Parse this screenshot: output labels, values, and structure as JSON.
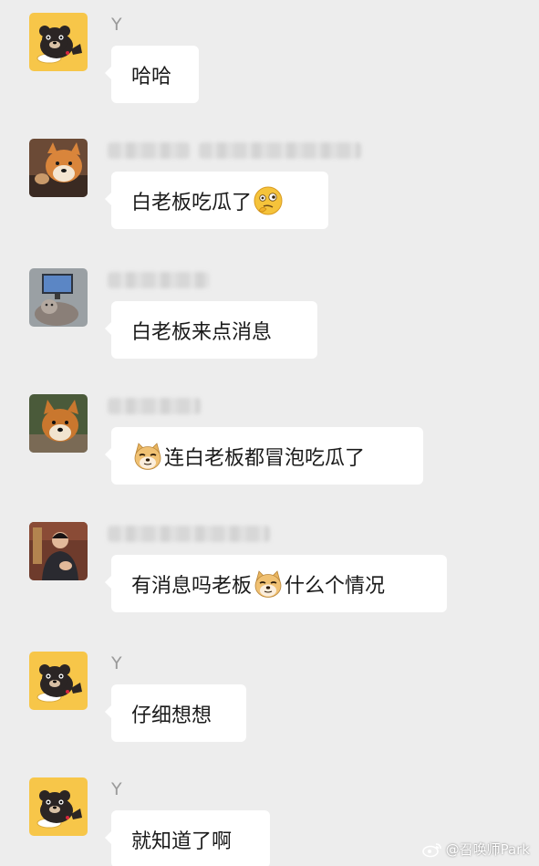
{
  "messages": [
    {
      "sender": "Y",
      "avatar": "bear-avatar",
      "text_before": "哈哈",
      "emoji": "",
      "text_after": ""
    },
    {
      "sender": "",
      "avatar": "shiba-avatar",
      "text_before": "白老板吃瓜了",
      "emoji": "thinking-emoji",
      "text_after": ""
    },
    {
      "sender": "",
      "avatar": "cat-monitor-avatar",
      "text_before": "白老板来点消息",
      "emoji": "",
      "text_after": ""
    },
    {
      "sender": "",
      "avatar": "shiba-dog-avatar",
      "text_before": "",
      "emoji": "doge-emoji",
      "text_after": "连白老板都冒泡吃瓜了"
    },
    {
      "sender": "",
      "avatar": "person-avatar",
      "text_before": "有消息吗老板",
      "emoji": "doge-emoji",
      "text_after": "什么个情况"
    },
    {
      "sender": "Y",
      "avatar": "bear-avatar",
      "text_before": "仔细想想",
      "emoji": "",
      "text_after": ""
    },
    {
      "sender": "Y",
      "avatar": "bear-avatar",
      "text_before": "就知道了啊",
      "emoji": "",
      "text_after": ""
    }
  ],
  "watermark": {
    "text": "@召唤师Park",
    "icon": "weibo-icon"
  },
  "colors": {
    "background": "#ededed",
    "bubble": "#ffffff",
    "sender_name": "#9a9a9a",
    "bear_avatar_bg": "#f7c649"
  }
}
